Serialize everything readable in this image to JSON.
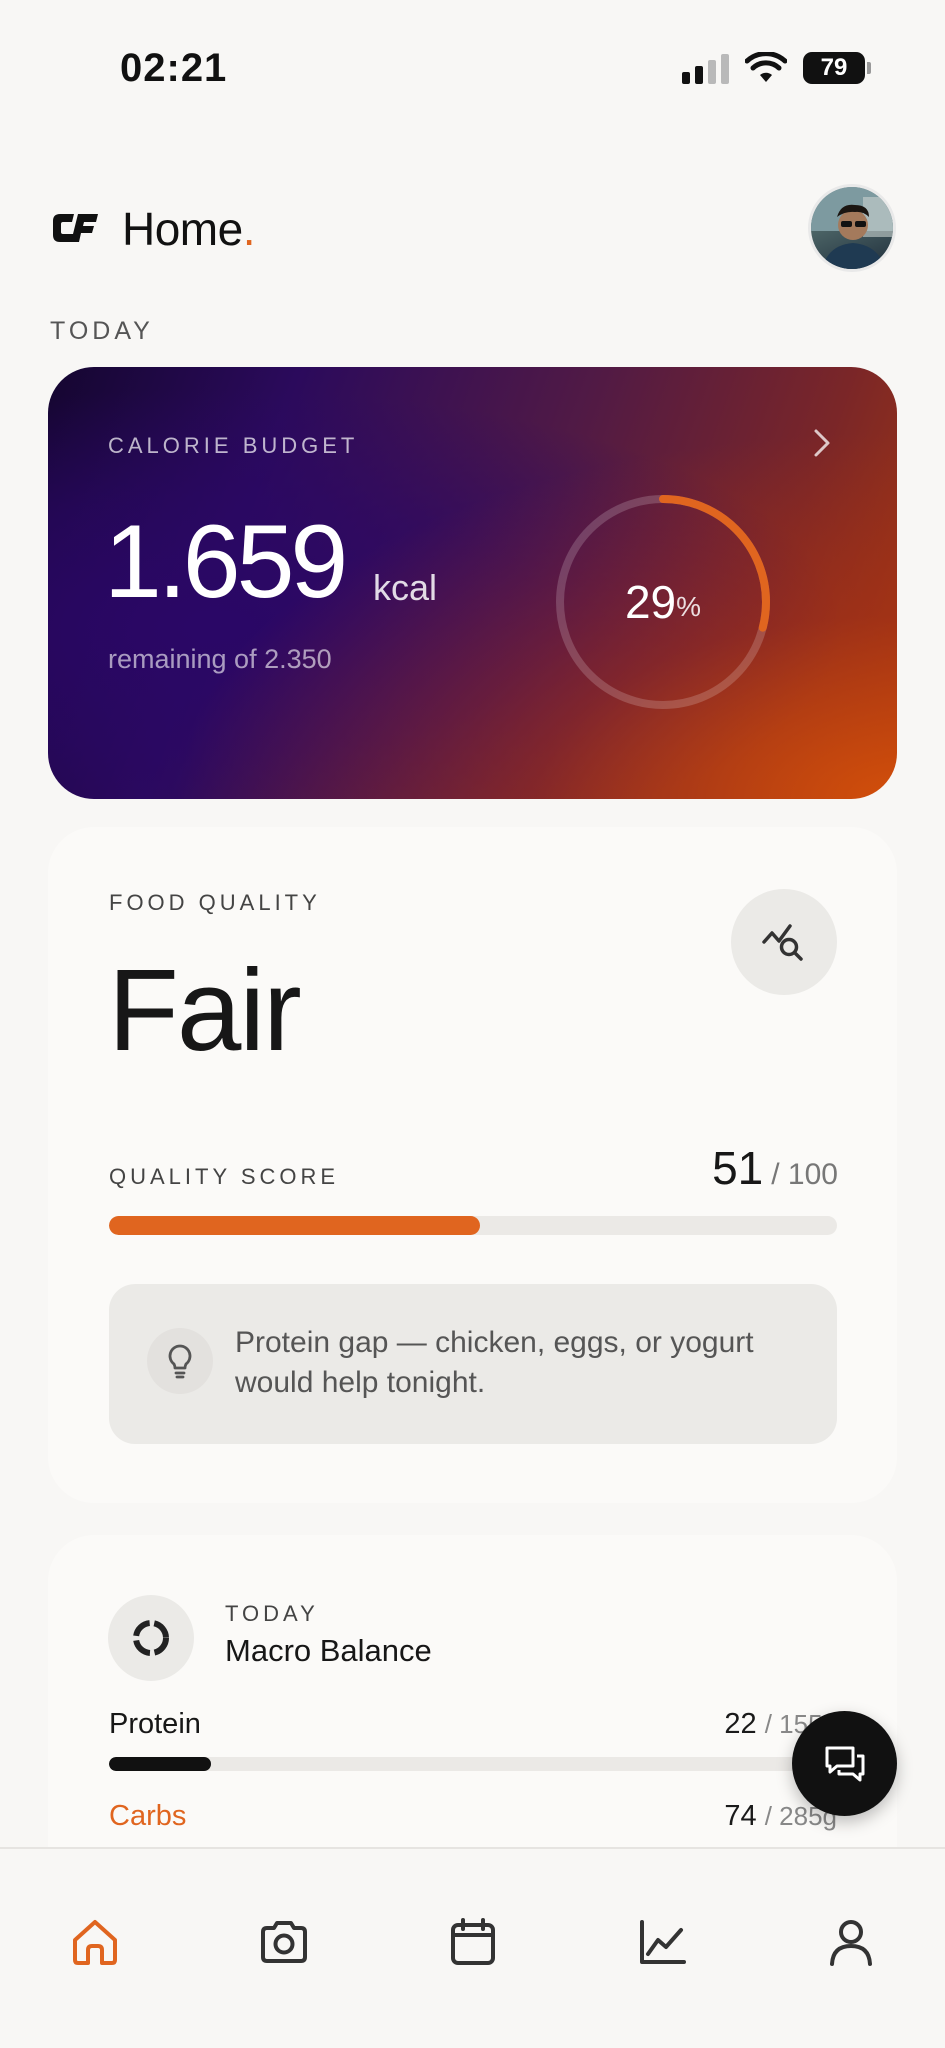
{
  "status_bar": {
    "time": "02:21",
    "battery": "79"
  },
  "header": {
    "title": "Home",
    "title_dot": "."
  },
  "section_label": "TODAY",
  "calorie_card": {
    "label": "CALORIE BUDGET",
    "remaining": "1.659",
    "unit": "kcal",
    "subtitle": "remaining of 2.350",
    "percent": "29",
    "percent_sign": "%",
    "progress_fraction": 0.29
  },
  "food_quality": {
    "label": "FOOD QUALITY",
    "rating": "Fair",
    "score_label": "QUALITY SCORE",
    "score": "51",
    "score_max": "/ 100",
    "score_fraction": 0.51,
    "tip": "Protein gap — chicken, eggs, or yogurt would help tonight."
  },
  "macro_balance": {
    "eyebrow": "TODAY",
    "title": "Macro Balance",
    "rows": [
      {
        "name": "Protein",
        "value": "22",
        "max": "/ 155g",
        "fraction": 0.14,
        "color": "#111111"
      },
      {
        "name": "Carbs",
        "value": "74",
        "max": "/ 285g",
        "fraction": 0.26,
        "color": "#e0651f"
      }
    ]
  },
  "colors": {
    "accent": "#e0651f",
    "text": "#171717",
    "background": "#f8f7f5"
  },
  "tab_bar": {
    "items": [
      {
        "icon": "home-icon",
        "active": true
      },
      {
        "icon": "camera-icon",
        "active": false
      },
      {
        "icon": "calendar-icon",
        "active": false
      },
      {
        "icon": "chart-icon",
        "active": false
      },
      {
        "icon": "profile-icon",
        "active": false
      }
    ]
  }
}
